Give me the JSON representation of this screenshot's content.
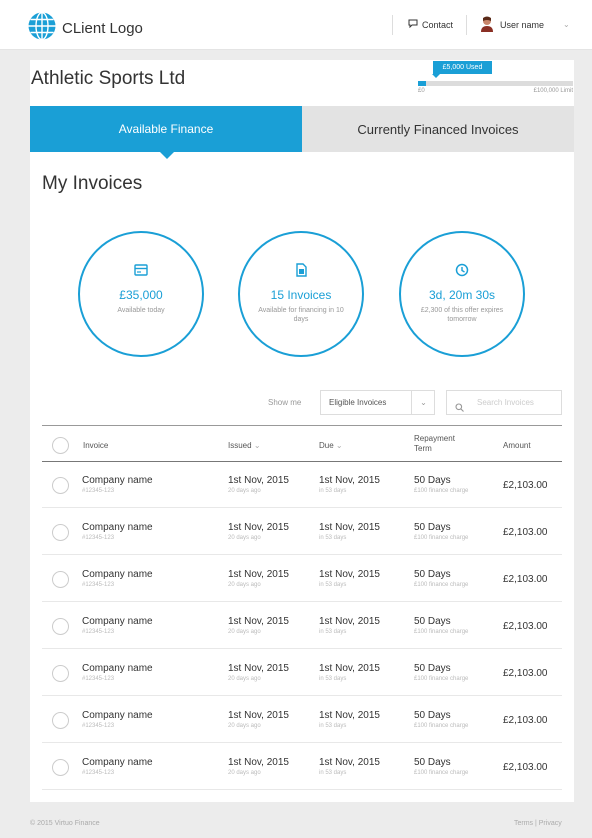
{
  "header": {
    "logo_text": "CLient Logo",
    "contact_label": "Contact",
    "user_label": "User name"
  },
  "account": {
    "company_name": "Athletic Sports Ltd",
    "credit_used_label": "£5,000 Used",
    "credit_min": "£0",
    "credit_max": "£100,000 Limit",
    "credit_used_fraction": 0.05
  },
  "tabs": [
    {
      "label": "Available Finance",
      "active": true
    },
    {
      "label": "Currently Financed Invoices",
      "active": false
    }
  ],
  "page_title": "My Invoices",
  "stats": [
    {
      "icon": "card-icon",
      "value": "£35,000",
      "sub": "Available today"
    },
    {
      "icon": "document-icon",
      "value": "15 Invoices",
      "sub": "Available for financing in 10 days"
    },
    {
      "icon": "clock-icon",
      "value": "3d, 20m 30s",
      "sub": "£2,300 of this offer expires tomorrow"
    }
  ],
  "filter": {
    "show_label": "Show me",
    "selected": "Eligible Invoices",
    "search_placeholder": "Search Invoices"
  },
  "table": {
    "headers": {
      "invoice": "Invoice",
      "issued": "Issued",
      "due": "Due",
      "repayment_line1": "Repayment",
      "repayment_line2": "Term",
      "amount": "Amount"
    },
    "rows": [
      {
        "company": "Company name",
        "ref": "#12345-123",
        "issued": "1st Nov, 2015",
        "issued_sub": "20 days ago",
        "due": "1st Nov, 2015",
        "due_sub": "in 53 days",
        "term": "50 Days",
        "term_sub": "£100 finance charge",
        "amount": "£2,103.00"
      },
      {
        "company": "Company name",
        "ref": "#12345-123",
        "issued": "1st Nov, 2015",
        "issued_sub": "20 days ago",
        "due": "1st Nov, 2015",
        "due_sub": "in 53 days",
        "term": "50 Days",
        "term_sub": "£100 finance charge",
        "amount": "£2,103.00"
      },
      {
        "company": "Company name",
        "ref": "#12345-123",
        "issued": "1st Nov, 2015",
        "issued_sub": "20 days ago",
        "due": "1st Nov, 2015",
        "due_sub": "in 53 days",
        "term": "50 Days",
        "term_sub": "£100 finance charge",
        "amount": "£2,103.00"
      },
      {
        "company": "Company name",
        "ref": "#12345-123",
        "issued": "1st Nov, 2015",
        "issued_sub": "20 days ago",
        "due": "1st Nov, 2015",
        "due_sub": "in 53 days",
        "term": "50 Days",
        "term_sub": "£100 finance charge",
        "amount": "£2,103.00"
      },
      {
        "company": "Company name",
        "ref": "#12345-123",
        "issued": "1st Nov, 2015",
        "issued_sub": "20 days ago",
        "due": "1st Nov, 2015",
        "due_sub": "in 53 days",
        "term": "50 Days",
        "term_sub": "£100 finance charge",
        "amount": "£2,103.00"
      },
      {
        "company": "Company name",
        "ref": "#12345-123",
        "issued": "1st Nov, 2015",
        "issued_sub": "20 days ago",
        "due": "1st Nov, 2015",
        "due_sub": "in 53 days",
        "term": "50 Days",
        "term_sub": "£100 finance charge",
        "amount": "£2,103.00"
      },
      {
        "company": "Company name",
        "ref": "#12345-123",
        "issued": "1st Nov, 2015",
        "issued_sub": "20 days ago",
        "due": "1st Nov, 2015",
        "due_sub": "in 53 days",
        "term": "50 Days",
        "term_sub": "£100 finance charge",
        "amount": "£2,103.00"
      }
    ]
  },
  "footer": {
    "copyright": "© 2015 Virtuo Finance",
    "links": "Terms | Privacy"
  },
  "colors": {
    "accent": "#1a9fd6",
    "background": "#ececec"
  }
}
